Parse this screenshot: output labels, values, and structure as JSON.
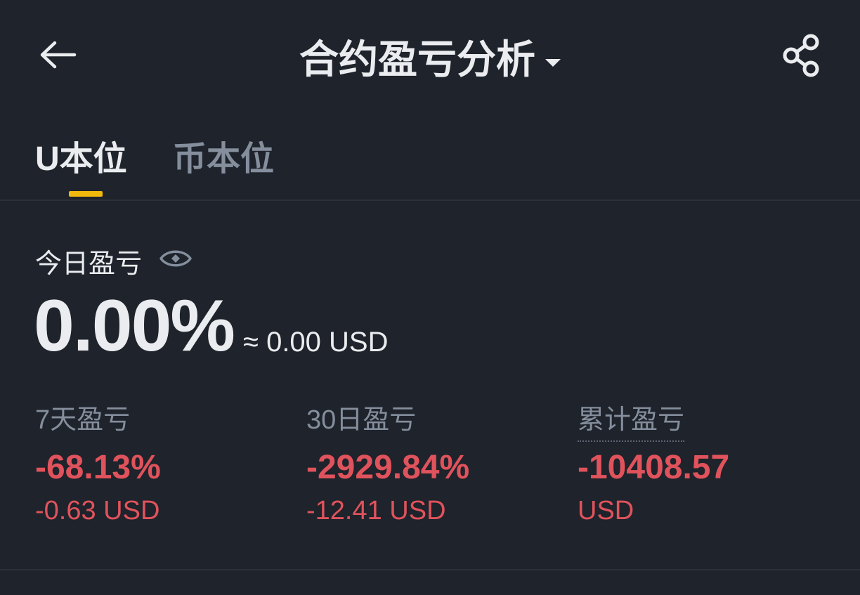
{
  "header": {
    "title": "合约盈亏分析",
    "back_icon": "back-arrow-icon",
    "share_icon": "share-icon"
  },
  "tabs": [
    {
      "label": "U本位",
      "active": true
    },
    {
      "label": "币本位",
      "active": false
    }
  ],
  "today": {
    "label": "今日盈亏",
    "percent": "0.00%",
    "approx_usd": "≈ 0.00 USD"
  },
  "stats": [
    {
      "label": "7天盈亏",
      "percent": "-68.13%",
      "usd": "-0.63 USD"
    },
    {
      "label": "30日盈亏",
      "percent": "-2929.84%",
      "usd": "-12.41 USD"
    },
    {
      "label": "累计盈亏",
      "percent": "-10408.57",
      "usd": "USD"
    }
  ],
  "colors": {
    "background": "#1f232b",
    "accent": "#f0b90b",
    "loss": "#e0535c",
    "muted": "#848e9c",
    "text": "#eaecef"
  }
}
